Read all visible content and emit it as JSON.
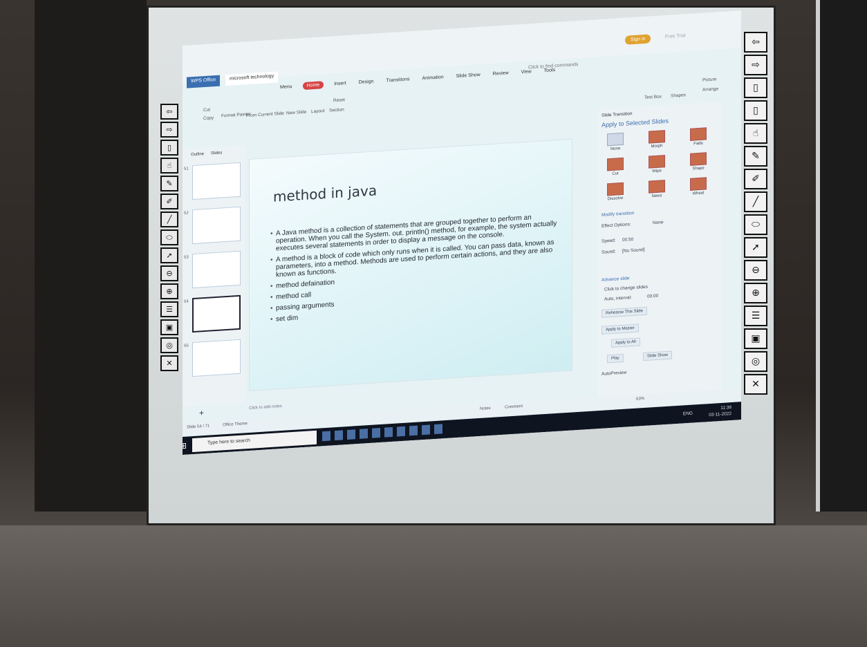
{
  "app": {
    "tab_wps": "WPS Office",
    "tab_doc": "microsoft technology",
    "sign_in": "Sign in",
    "free_trial": "Free Trial",
    "command_search": "Click to find commands"
  },
  "ribbon_tabs": [
    "Menu",
    "Home",
    "Insert",
    "Design",
    "Transitions",
    "Animation",
    "Slide Show",
    "Review",
    "View",
    "Tools"
  ],
  "ribbon": {
    "cut": "Cut",
    "copy": "Copy",
    "format_painter": "Format Painter",
    "from_current_slide": "From Current Slide",
    "new_slide": "New Slide",
    "layout": "Layout",
    "reset": "Reset",
    "section": "Section",
    "text_box": "Text Box",
    "shapes": "Shapes",
    "picture": "Picture",
    "arrange": "Arrange"
  },
  "left_pane": {
    "tab_outline": "Outline",
    "tab_slides": "Slides",
    "thumb_numbers": [
      "51",
      "52",
      "53",
      "54",
      "55"
    ]
  },
  "slide": {
    "title": "method in java",
    "bullets": [
      "A Java method is a collection of statements that are grouped together to perform an operation. When you call the System. out. println() method, for example, the system actually executes several statements in order to display a message on the console.",
      "A method is a block of code which only runs when it is called. You can pass data, known as parameters, into a method. Methods are used to perform certain actions, and they are also known as functions.",
      "method defaination",
      "method call",
      "passing arguments",
      "set dim"
    ]
  },
  "notes_placeholder": "Click to add notes",
  "transition_pane": {
    "header": "Slide Transition",
    "apply_selected": "Apply to Selected Slides",
    "effects": [
      "None",
      "Morph",
      "Fade",
      "Cut",
      "Wipe",
      "Shape",
      "Dissolve",
      "News",
      "Wheel"
    ],
    "modify": "Modify transition",
    "effect_options": "Effect Options:",
    "effect_value": "None",
    "speed_label": "Speed:",
    "speed_value": "00.50",
    "sound_label": "Sound:",
    "sound_value": "[No Sound]",
    "advance": "Advance slide",
    "click_to_change": "Click to change slides",
    "auto_interval": "Auto, interval:",
    "auto_value": "00:00",
    "rehearse": "Rehearse This Slide",
    "apply_master": "Apply to Master",
    "apply_all": "Apply to All",
    "play": "Play",
    "slide_show": "Slide Show",
    "autopreview": "AutoPreview"
  },
  "statusbar": {
    "slide_info": "Slide 54 / 71",
    "theme": "Office Theme",
    "notes": "Notes",
    "comment": "Comment",
    "zoom": "63%"
  },
  "taskbar": {
    "search_placeholder": "Type here to search",
    "lang": "ENG",
    "time": "11:38",
    "date": "03-11-2022"
  },
  "colors": {
    "signin": "#e0a230",
    "home_tab": "#d64545",
    "accent_blue": "#3a6fb0",
    "taskbar": "#0e1420"
  }
}
